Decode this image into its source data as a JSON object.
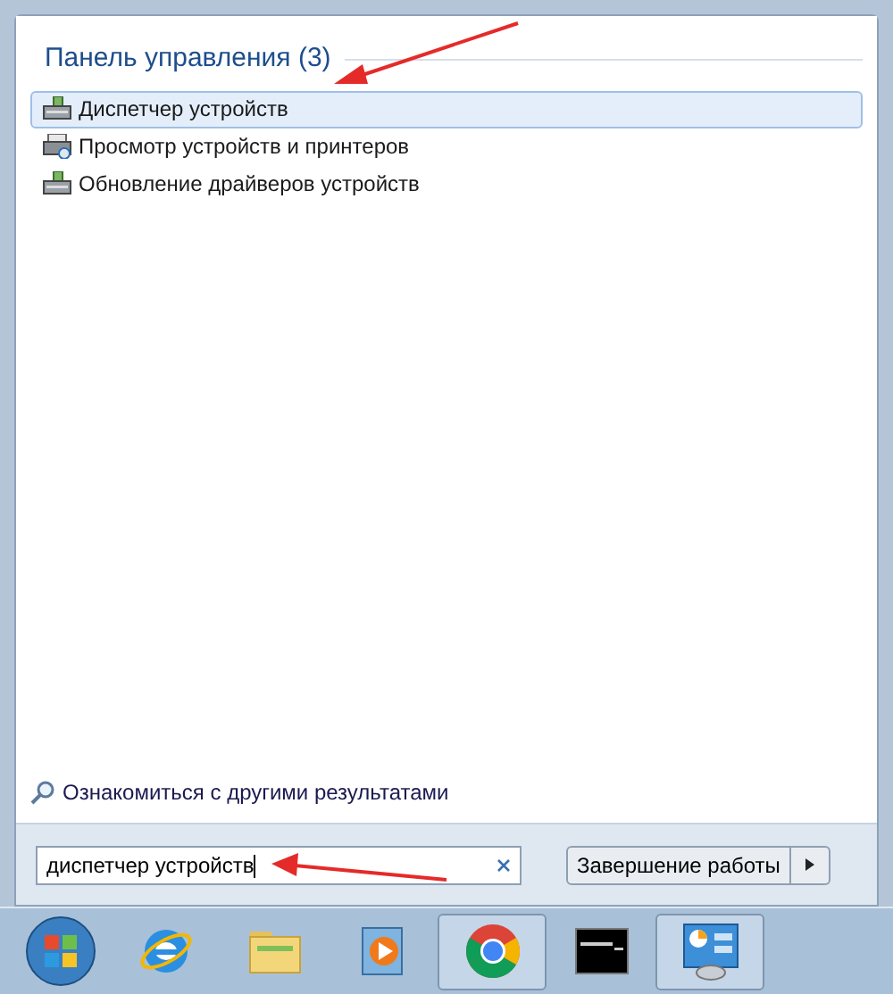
{
  "results": {
    "heading": "Панель управления (3)",
    "items": [
      {
        "label": "Диспетчер устройств",
        "kind": "device",
        "selected": true
      },
      {
        "label": "Просмотр устройств и принтеров",
        "kind": "printer",
        "selected": false
      },
      {
        "label": "Обновление драйверов устройств",
        "kind": "device",
        "selected": false
      }
    ]
  },
  "more_results": "Ознакомиться с другими результатами",
  "search": {
    "value": "диспетчер устройств"
  },
  "shutdown": {
    "label": "Завершение работы"
  },
  "taskbar": [
    {
      "kind": "start",
      "running": false
    },
    {
      "kind": "browser",
      "running": false
    },
    {
      "kind": "folder",
      "running": false
    },
    {
      "kind": "media",
      "running": false
    },
    {
      "kind": "chrome",
      "running": true
    },
    {
      "kind": "terminal",
      "running": false
    },
    {
      "kind": "control",
      "running": true
    }
  ]
}
